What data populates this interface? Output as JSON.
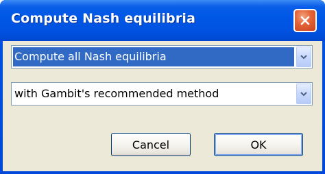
{
  "window": {
    "title": "Compute Nash equilibria",
    "close_icon": "close-icon"
  },
  "dialog": {
    "method_select": {
      "value": "Compute all Nash equilibria",
      "state": "focused-selected"
    },
    "algorithm_select": {
      "value": "with Gambit's recommended method"
    },
    "buttons": {
      "cancel_label": "Cancel",
      "ok_label": "OK"
    }
  },
  "colors": {
    "titlebar": "#0054e3",
    "dialog_bg": "#ece9d8",
    "selection": "#316ac5",
    "close_button": "#e5663a"
  }
}
